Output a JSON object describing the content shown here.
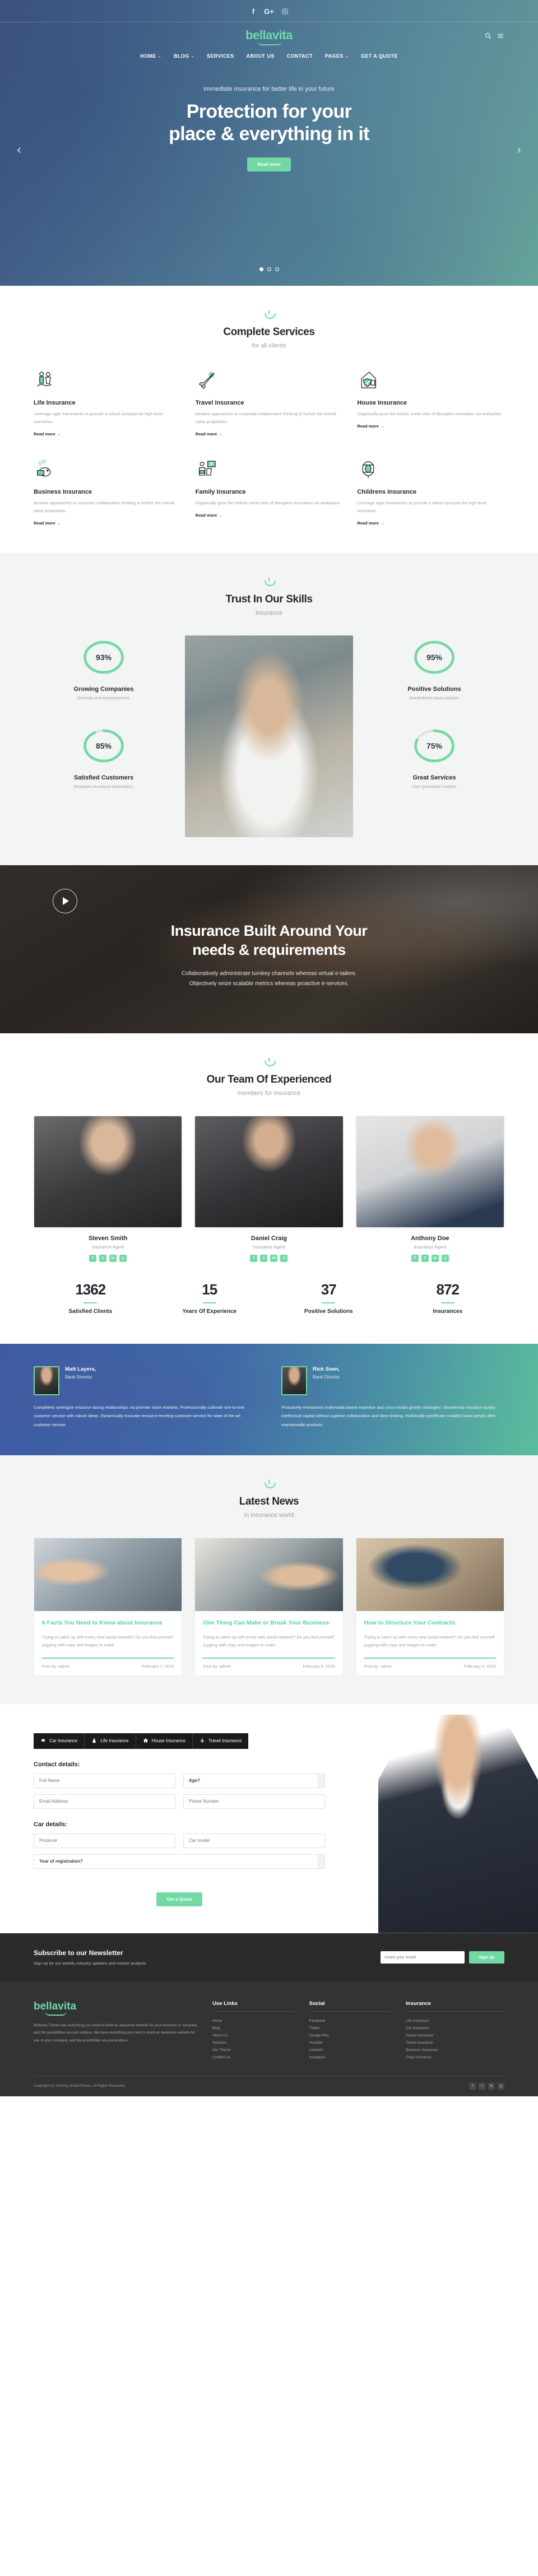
{
  "brand": {
    "name": "bellavita"
  },
  "topbar": {
    "socials": [
      {
        "name": "facebook-icon",
        "glyph": "f"
      },
      {
        "name": "google-plus-icon",
        "glyph": "G+"
      },
      {
        "name": "instagram-icon",
        "glyph": "▣"
      }
    ]
  },
  "nav": {
    "items": [
      {
        "label": "HOME",
        "caret": "⌄"
      },
      {
        "label": "BLOG",
        "caret": "⌄"
      },
      {
        "label": "SERVICES",
        "caret": ""
      },
      {
        "label": "ABOUT US",
        "caret": ""
      },
      {
        "label": "CONTACT",
        "caret": ""
      },
      {
        "label": "PAGES",
        "caret": "⌄"
      },
      {
        "label": "GET A QUOTE",
        "caret": ""
      }
    ],
    "search_icon": "search-icon",
    "menu_icon": "hamburger-icon"
  },
  "hero": {
    "subtitle": "Immediate insurance for better life in your future",
    "title_line1": "Protection for your",
    "title_line2": "place & everything in it",
    "cta": "Read more",
    "prev": "‹",
    "next": "›",
    "slides": 3,
    "active_slide": 1
  },
  "services": {
    "title": "Complete Services",
    "subtitle": "for all clients",
    "read_more": "Read more →",
    "items": [
      {
        "title": "Life Insurance",
        "desc": "Leverage agile frameworks to provide a robust synopsis for high level overviews.",
        "icon": "family-icon"
      },
      {
        "title": "Travel Insurance",
        "desc": "Iterative approaches to corporate collaborative thinking to further the overall value proposition.",
        "icon": "airplane-icon"
      },
      {
        "title": "House Insurance",
        "desc": "Organically grow the holistic world view of disruptive innovation via workplace",
        "icon": "house-shield-icon"
      },
      {
        "title": "Business Insurance",
        "desc": "Iterative approaches to corporate collaborative thinking to further the overall value proposition.",
        "icon": "piggy-bank-icon"
      },
      {
        "title": "Family Insurance",
        "desc": "Organically grow the holistic world view of disruptive innovation via workplace.",
        "icon": "family-chat-icon"
      },
      {
        "title": "Childrens Insurance",
        "desc": "Leverage agile frameworks to provide a robust synopsis for high level overviews.",
        "icon": "lifebuoy-icon"
      }
    ]
  },
  "skills": {
    "title": "Trust In Our Skills",
    "subtitle": "insurance",
    "left": [
      {
        "pct": 93,
        "pct_label": "93%",
        "name": "Growing Companies",
        "desc": "Diversity and empowerment."
      },
      {
        "pct": 85,
        "pct_label": "85%",
        "name": "Satisfied Customers",
        "desc": "Strategies to ensure domination."
      }
    ],
    "right": [
      {
        "pct": 95,
        "pct_label": "95%",
        "name": "Positive Solutions",
        "desc": "Streamlined cloud solution."
      },
      {
        "pct": 75,
        "pct_label": "75%",
        "name": "Great Services",
        "desc": "User generated content."
      }
    ]
  },
  "video_cta": {
    "title_line1": "Insurance Built Around Your",
    "title_line2": "needs & requirements",
    "desc_line1": "Collaboratively administrate turnkey channels whereas virtual e-tailers.",
    "desc_line2": "Objectively seize scalable metrics whereas proactive e-services.",
    "play_icon": "play-icon"
  },
  "team": {
    "title": "Our Team Of Experienced",
    "subtitle": "members for insurance",
    "socials": [
      "f",
      "t",
      "in",
      "v"
    ],
    "members": [
      {
        "name": "Steven Smith",
        "role": "Insurance Agent"
      },
      {
        "name": "Daniel Craig",
        "role": "Insurance Agent"
      },
      {
        "name": "Anthony Doe",
        "role": "Insurance Agent"
      }
    ],
    "counters": [
      {
        "value": "1362",
        "label": "Satisfied Clients"
      },
      {
        "value": "15",
        "label": "Years Of Experience"
      },
      {
        "value": "37",
        "label": "Positive Solutions"
      },
      {
        "value": "872",
        "label": "Insurances"
      }
    ]
  },
  "testimonials": [
    {
      "name": "Matt Layers,",
      "role": "Bank Director",
      "body": "Completely synergize resource taxing relationships via premier niche markets. Professionally cultivate one-to-one customer service with robust ideas. Dynamically innovate resource-leveling customer service for state of the art customer service."
    },
    {
      "name": "Rick Sven,",
      "role": "Bank Director",
      "body": "Proactively envisioned multimedia based expertise and cross-media growth strategies. Seamlessly visualize quality intellectual capital without superior collaboration and idea-sharing. Holistically pontificate installed base portals after maintainable products."
    }
  ],
  "news": {
    "title": "Latest News",
    "subtitle": "in insurance world",
    "posts": [
      {
        "title": "6 Facts You Need to Know about Insurance",
        "excerpt": "Trying to catch up with every new social network? Do you find yourself juggling with copy and images to make",
        "author": "Post by: admin",
        "date": "February 7, 2016"
      },
      {
        "title": "One Thing Can Make or Break Your Business",
        "excerpt": "Trying to catch up with every new social network? Do you find yourself juggling with copy and images to make",
        "author": "Post by: admin",
        "date": "February 5, 2016"
      },
      {
        "title": "How to Structure Your Contracts",
        "excerpt": "Trying to catch up with every new social network? Do you find yourself juggling with copy and images to make",
        "author": "Post by: admin",
        "date": "February 4, 2016"
      }
    ]
  },
  "quote": {
    "tabs": [
      {
        "label": "Car Insurance",
        "icon": "car-icon",
        "glyph": "◭",
        "active": true
      },
      {
        "label": "Life Insurance",
        "icon": "life-icon",
        "glyph": "❦",
        "active": false
      },
      {
        "label": "House Insurance",
        "icon": "house-icon",
        "glyph": "⌂",
        "active": false
      },
      {
        "label": "Travel Insurance",
        "icon": "airplane-icon",
        "glyph": "✈",
        "active": false
      }
    ],
    "contact_heading": "Contact details:",
    "car_heading": "Car details:",
    "fields": {
      "full_name": "Full Name",
      "age": "Age?",
      "email": "Email Address",
      "phone": "Phone Number",
      "producer": "Producer",
      "car_model": "Car model",
      "year": "Year of registration?"
    },
    "submit": "Get a Quote"
  },
  "newsletter": {
    "title": "Subscribe to our Newsletter",
    "subtitle": "Sign up for our weekly industry updates and market analysis.",
    "placeholder": "Insert your email",
    "button": "Sign up"
  },
  "footer": {
    "logo": "bellavita",
    "about": "Bellavita Theme has everything you need to build an awesome website for your business or company, and the possibilities are just endless. We have everything you need to build an awesome website for you or your company, and the possibilities are just endless.",
    "columns": [
      {
        "heading": "Use Links",
        "items": [
          "Home",
          "Blog",
          "About Us",
          "Services",
          "Our Theme",
          "Contact Us"
        ]
      },
      {
        "heading": "Social",
        "items": [
          "Facebook",
          "Twitter",
          "Google Plus",
          "Youtube",
          "Linkedin",
          "Instagram"
        ]
      },
      {
        "heading": "Insurance",
        "items": [
          "Life Insurance",
          "Car Insurance",
          "House Insurance",
          "Travel Insurance",
          "Business Insurance",
          "Dogs Insurance"
        ]
      }
    ],
    "copyright": "Copyright (c) 2016 by ModelTheme. All Rights Reserved.",
    "socials": [
      "f",
      "t",
      "in",
      "g"
    ]
  },
  "colors": {
    "accent": "#72d9a4",
    "dark": "#23282d",
    "muted": "#9aa1a8"
  }
}
